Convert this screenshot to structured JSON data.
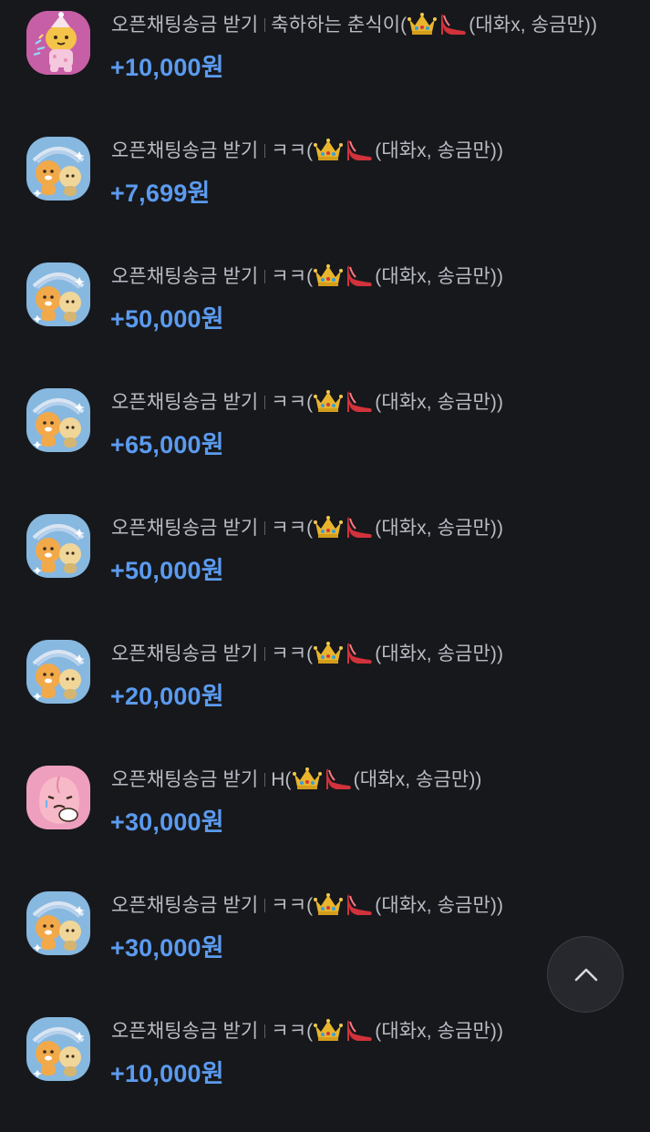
{
  "transactions": [
    {
      "avatar": "pink-character-avatar",
      "type": "오픈채팅송금 받기",
      "memo_prefix": "축하하는 춘식이(",
      "memo_suffix": "(대화x, 송금만))",
      "amount": "+10,000원"
    },
    {
      "avatar": "blue-character-avatar",
      "type": "오픈채팅송금 받기",
      "memo_prefix": "ㅋㅋ(",
      "memo_suffix": "(대화x, 송금만))",
      "amount": "+7,699원"
    },
    {
      "avatar": "blue-character-avatar",
      "type": "오픈채팅송금 받기",
      "memo_prefix": "ㅋㅋ(",
      "memo_suffix": "(대화x, 송금만))",
      "amount": "+50,000원"
    },
    {
      "avatar": "blue-character-avatar",
      "type": "오픈채팅송금 받기",
      "memo_prefix": "ㅋㅋ(",
      "memo_suffix": "(대화x, 송금만))",
      "amount": "+65,000원"
    },
    {
      "avatar": "blue-character-avatar",
      "type": "오픈채팅송금 받기",
      "memo_prefix": "ㅋㅋ(",
      "memo_suffix": "(대화x, 송금만))",
      "amount": "+50,000원"
    },
    {
      "avatar": "blue-character-avatar",
      "type": "오픈채팅송금 받기",
      "memo_prefix": "ㅋㅋ(",
      "memo_suffix": "(대화x, 송금만))",
      "amount": "+20,000원"
    },
    {
      "avatar": "peach-character-avatar",
      "type": "오픈채팅송금 받기",
      "memo_prefix": "H(",
      "memo_suffix": "(대화x, 송금만))",
      "amount": "+30,000원"
    },
    {
      "avatar": "blue-character-avatar",
      "type": "오픈채팅송금 받기",
      "memo_prefix": "ㅋㅋ(",
      "memo_suffix": "(대화x, 송금만))",
      "amount": "+30,000원"
    },
    {
      "avatar": "blue-character-avatar",
      "type": "오픈채팅송금 받기",
      "memo_prefix": "ㅋㅋ(",
      "memo_suffix": "(대화x, 송금만))",
      "amount": "+10,000원"
    }
  ],
  "icons": {
    "crown": "crown-emoji-icon",
    "heel": "high-heel-emoji-icon",
    "scroll_top": "chevron-up-icon"
  },
  "colors": {
    "background": "#17181c",
    "amount": "#5b9bef",
    "text": "#b9bcc4",
    "button_bg": "#27282d"
  }
}
